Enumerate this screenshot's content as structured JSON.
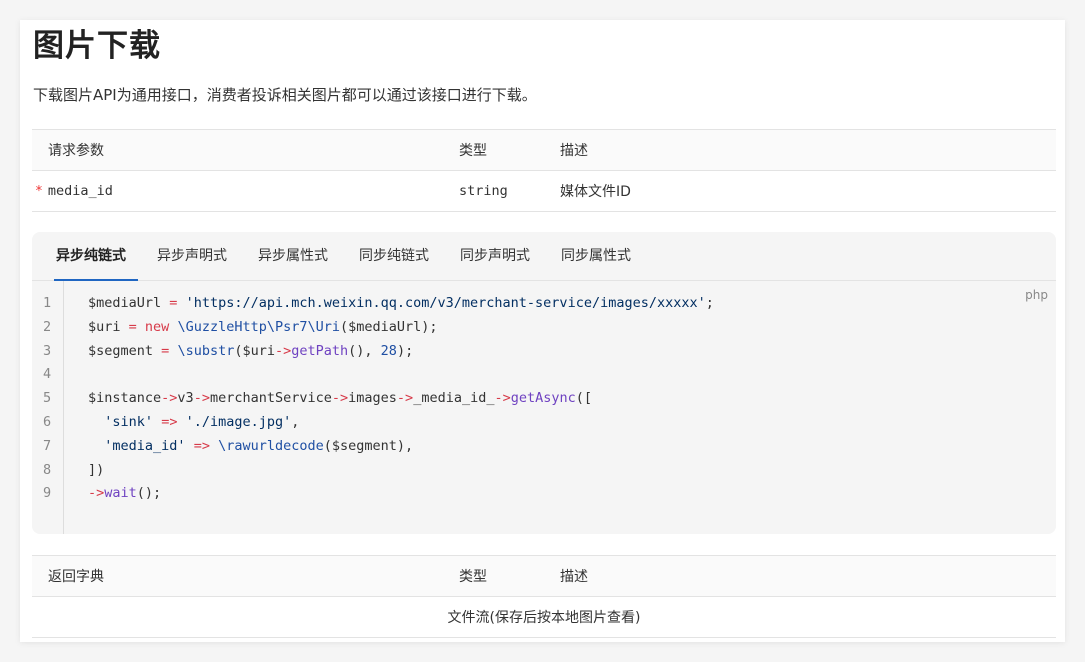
{
  "page": {
    "title": "图片下载",
    "description": "下载图片API为通用接口，消费者投诉相关图片都可以通过该接口进行下载。"
  },
  "request_table": {
    "headers": [
      "请求参数",
      "类型",
      "描述"
    ],
    "rows": [
      {
        "required": "*",
        "name": "media_id",
        "type": "string",
        "desc": "媒体文件ID"
      }
    ]
  },
  "code_block": {
    "tabs": [
      "异步纯链式",
      "异步声明式",
      "异步属性式",
      "同步纯链式",
      "同步声明式",
      "同步属性式"
    ],
    "active_tab": 0,
    "language": "php",
    "line_numbers": [
      "1",
      "2",
      "3",
      "4",
      "5",
      "6",
      "7",
      "8",
      "9"
    ],
    "lines": [
      "$mediaUrl = 'https://api.mch.weixin.qq.com/v3/merchant-service/images/xxxxx';",
      "$uri = new \\GuzzleHttp\\Psr7\\Uri($mediaUrl);",
      "$segment = \\substr($uri->getPath(), 28);",
      "",
      "$instance->v3->merchantService->images->_media_id_->getAsync([",
      "  'sink' => './image.jpg',",
      "  'media_id' => \\rawurldecode($segment),",
      "])",
      "->wait();"
    ]
  },
  "return_table": {
    "headers": [
      "返回字典",
      "类型",
      "描述"
    ],
    "body": "文件流(保存后按本地图片查看)"
  },
  "colors": {
    "tab_active_underline": "#1f66c2",
    "required_star": "#ee3333",
    "keyword_red": "#d73a49",
    "keyword_blue": "#1f4fa3",
    "method_purple": "#6f42c1"
  }
}
